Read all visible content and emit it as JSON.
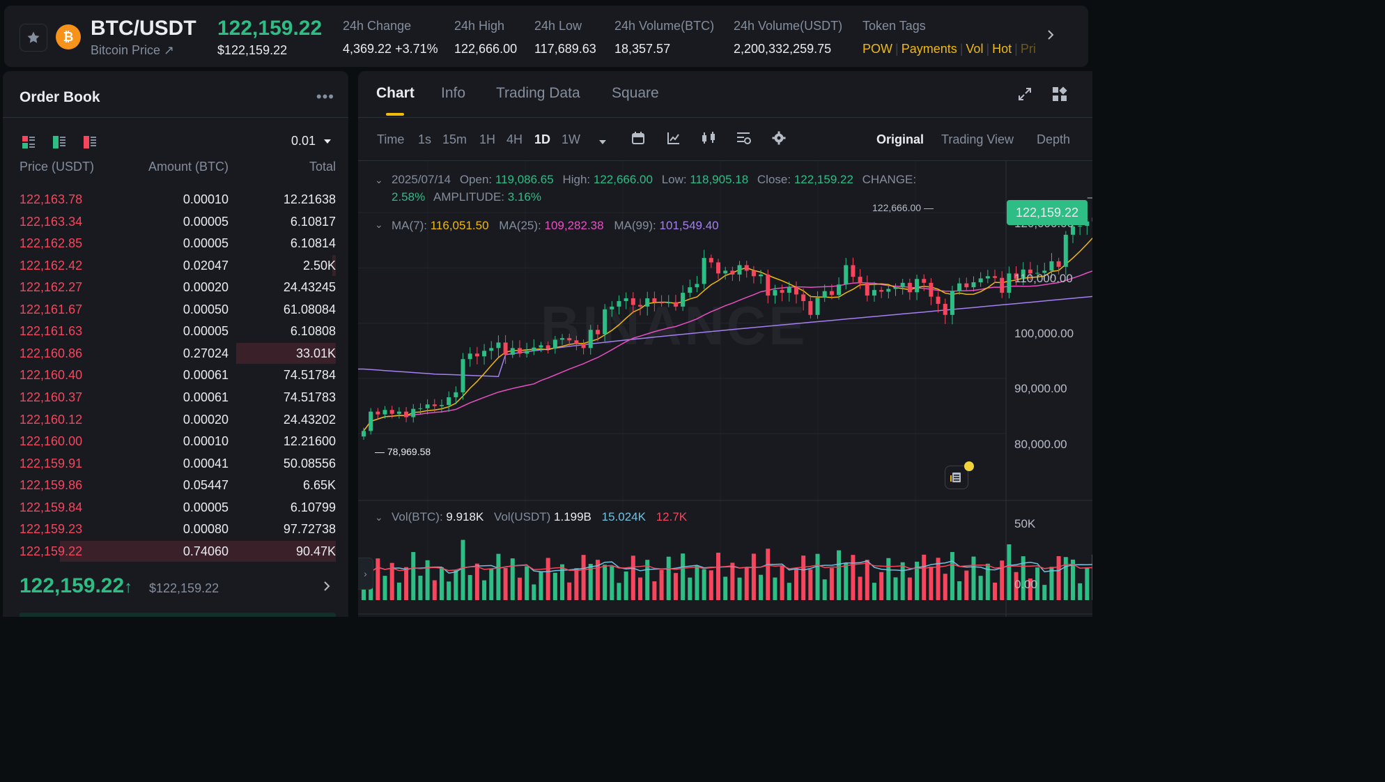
{
  "header": {
    "pair": "BTC/USDT",
    "subtitle": "Bitcoin Price ↗",
    "last_price": "122,159.22",
    "last_price_usd": "$122,159.22",
    "stats": [
      {
        "label": "24h Change",
        "value": "4,369.22 +3.71%",
        "color": "#2ebd85"
      },
      {
        "label": "24h High",
        "value": "122,666.00"
      },
      {
        "label": "24h Low",
        "value": "117,689.63"
      },
      {
        "label": "24h Volume(BTC)",
        "value": "18,357.57"
      },
      {
        "label": "24h Volume(USDT)",
        "value": "2,200,332,259.75"
      }
    ],
    "tags_label": "Token Tags",
    "tags": [
      "POW",
      "Payments",
      "Vol",
      "Hot",
      "Pri"
    ]
  },
  "order_book": {
    "title": "Order Book",
    "precision": "0.01",
    "columns": [
      "Price (USDT)",
      "Amount (BTC)",
      "Total"
    ],
    "asks": [
      {
        "price": "122,163.78",
        "amount": "0.00010",
        "total": "12.21638",
        "depth": 0
      },
      {
        "price": "122,163.34",
        "amount": "0.00005",
        "total": "6.10817",
        "depth": 0
      },
      {
        "price": "122,162.85",
        "amount": "0.00005",
        "total": "6.10814",
        "depth": 0
      },
      {
        "price": "122,162.42",
        "amount": "0.02047",
        "total": "2.50K",
        "depth": 0.01
      },
      {
        "price": "122,162.27",
        "amount": "0.00020",
        "total": "24.43245",
        "depth": 0
      },
      {
        "price": "122,161.67",
        "amount": "0.00050",
        "total": "61.08084",
        "depth": 0
      },
      {
        "price": "122,161.63",
        "amount": "0.00005",
        "total": "6.10808",
        "depth": 0
      },
      {
        "price": "122,160.86",
        "amount": "0.27024",
        "total": "33.01K",
        "depth": 0.31
      },
      {
        "price": "122,160.40",
        "amount": "0.00061",
        "total": "74.51784",
        "depth": 0
      },
      {
        "price": "122,160.37",
        "amount": "0.00061",
        "total": "74.51783",
        "depth": 0
      },
      {
        "price": "122,160.12",
        "amount": "0.00020",
        "total": "24.43202",
        "depth": 0
      },
      {
        "price": "122,160.00",
        "amount": "0.00010",
        "total": "12.21600",
        "depth": 0
      },
      {
        "price": "122,159.91",
        "amount": "0.00041",
        "total": "50.08556",
        "depth": 0
      },
      {
        "price": "122,159.86",
        "amount": "0.05447",
        "total": "6.65K",
        "depth": 0
      },
      {
        "price": "122,159.84",
        "amount": "0.00005",
        "total": "6.10799",
        "depth": 0
      },
      {
        "price": "122,159.23",
        "amount": "0.00080",
        "total": "97.72738",
        "depth": 0
      },
      {
        "price": "122,159.22",
        "amount": "0.74060",
        "total": "90.47K",
        "depth": 0.86
      }
    ],
    "last_price": "122,159.22",
    "last_arrow": "↑",
    "last_price_usd": "$122,159.22"
  },
  "chart_panel": {
    "tabs": [
      "Chart",
      "Info",
      "Trading Data",
      "Square"
    ],
    "active_tab": "Chart",
    "timeframes": [
      "Time",
      "1s",
      "15m",
      "1H",
      "4H",
      "1D",
      "1W"
    ],
    "active_timeframe": "1D",
    "views": [
      "Original",
      "Trading View",
      "Depth"
    ],
    "active_view": "Original",
    "ohlc": {
      "date": "2025/07/14",
      "open_label": "Open:",
      "open": "119,086.65",
      "high_label": "High:",
      "high": "122,666.00",
      "low_label": "Low:",
      "low": "118,905.18",
      "close_label": "Close:",
      "close": "122,159.22",
      "change_label": "CHANGE:",
      "change": "2.58%",
      "amplitude_label": "AMPLITUDE:",
      "amplitude": "3.16%"
    },
    "ma": {
      "ma7_label": "MA(7):",
      "ma7": "116,051.50",
      "ma7_color": "#f0b90b",
      "ma25_label": "MA(25):",
      "ma25": "109,282.38",
      "ma25_color": "#e84fc2",
      "ma99_label": "MA(99):",
      "ma99": "101,549.40",
      "ma99_color": "#a77ff5"
    },
    "price_tag": "122,159.22",
    "y_ticks": [
      "120,000.00",
      "110,000.00",
      "100,000.00",
      "90,000.00",
      "80,000.00"
    ],
    "high_marker": "122,666.00 —",
    "low_marker": "— 78,969.58",
    "watermark": "BINANCE",
    "volume": {
      "btc_label": "Vol(BTC):",
      "btc": "9.918K",
      "usdt_label": "Vol(USDT)",
      "usdt": "1.199B",
      "ma1": "15.024K",
      "ma1_color": "#6fc3e0",
      "ma2": "12.7K",
      "ma2_color": "#f6465d",
      "ticks": [
        "50K",
        "0.00"
      ]
    }
  },
  "colors": {
    "up": "#2ebd85",
    "down": "#f6465d",
    "accent": "#f0b90b",
    "bg": "#0b0e11",
    "panel": "#181a20"
  },
  "chart_data": {
    "type": "candlestick",
    "interval": "1D",
    "y_range": [
      75000,
      125000
    ],
    "closes": [
      80500,
      84000,
      83500,
      84300,
      83600,
      84000,
      83000,
      84500,
      84600,
      85300,
      85000,
      85200,
      86600,
      87500,
      93500,
      94500,
      94000,
      95000,
      95500,
      96500,
      94300,
      95500,
      94500,
      95000,
      95600,
      96000,
      95400,
      97000,
      97300,
      96900,
      96200,
      95500,
      98800,
      98000,
      102500,
      103000,
      104000,
      104500,
      103300,
      103000,
      104500,
      103800,
      103600,
      103800,
      103000,
      105500,
      106500,
      107100,
      111800,
      111000,
      109000,
      109500,
      108800,
      110500,
      109500,
      108500,
      108800,
      105000,
      106000,
      105500,
      106500,
      105200,
      104000,
      101500,
      104600,
      105800,
      105100,
      107000,
      110500,
      108400,
      107200,
      105000,
      106000,
      105700,
      106200,
      106500,
      107300,
      105600,
      108000,
      107300,
      104800,
      103500,
      101500,
      105800,
      107200,
      106500,
      107400,
      108100,
      108500,
      108200,
      105500,
      109000,
      108000,
      109700,
      109000,
      109100,
      109500,
      111200,
      110200,
      116000,
      117500,
      117600,
      118400,
      119100,
      122159
    ]
  }
}
